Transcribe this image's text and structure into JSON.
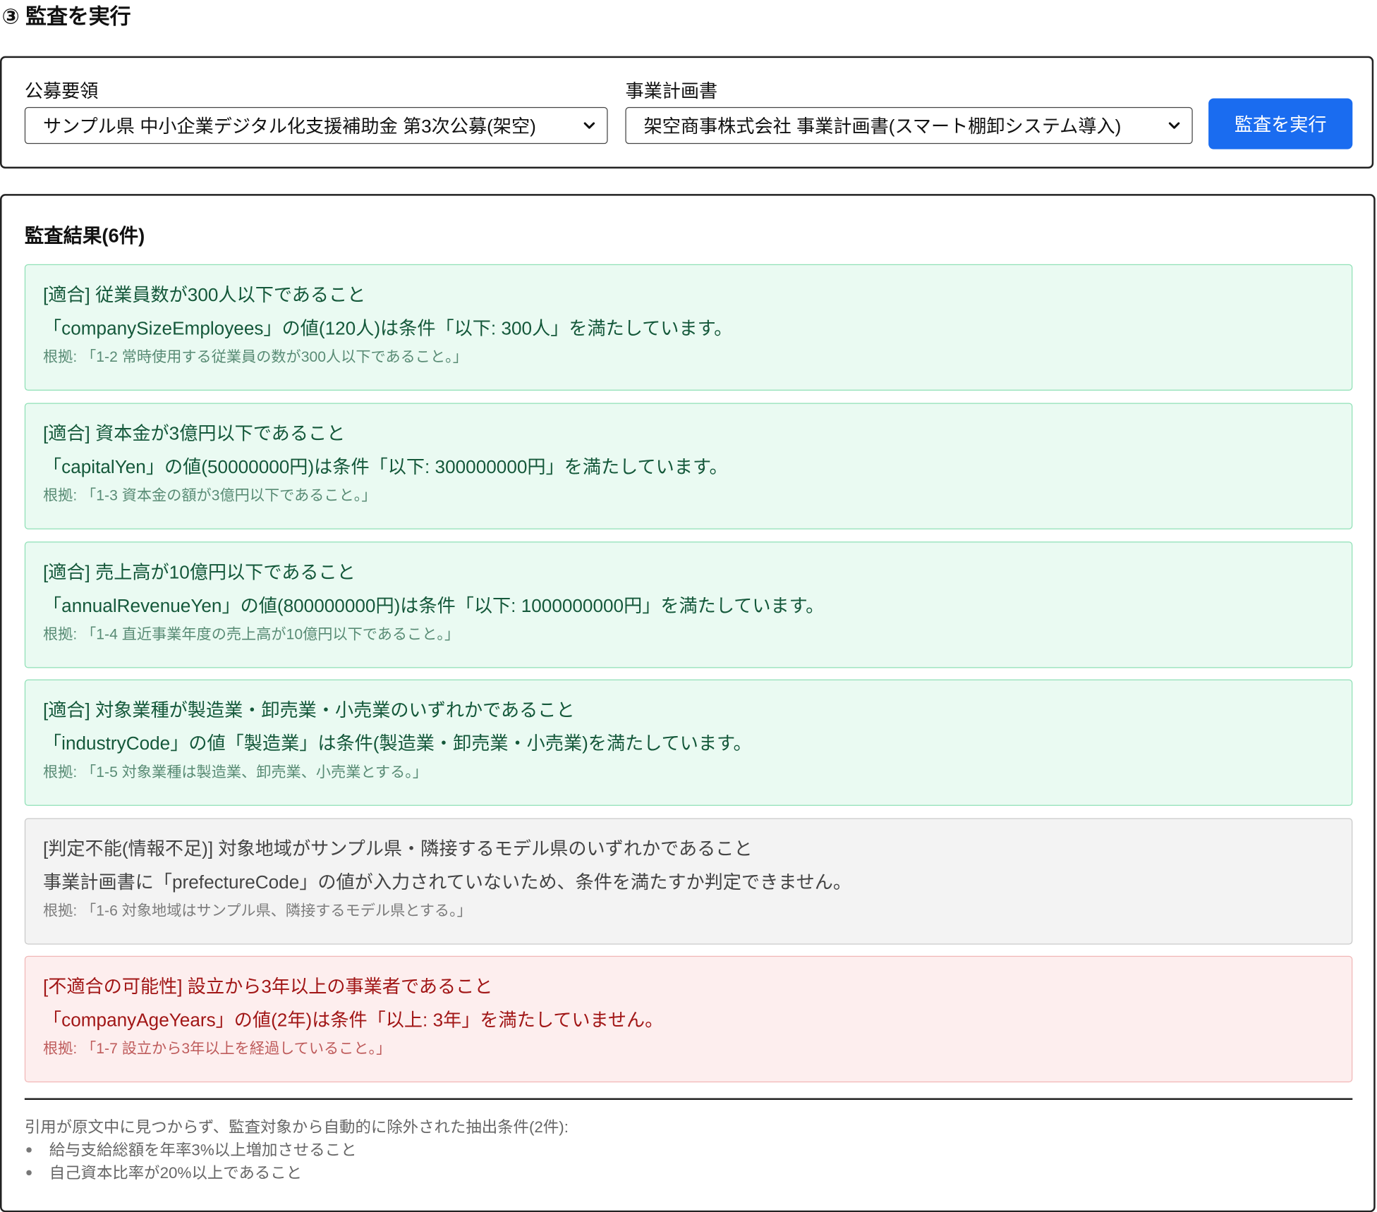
{
  "section": {
    "title": "③ 監査を実行"
  },
  "controls": {
    "guideline_label": "公募要領",
    "guideline_value": "サンプル県 中小企業デジタル化支援補助金 第3次公募(架空)",
    "plan_label": "事業計画書",
    "plan_value": "架空商事株式会社 事業計画書(スマート棚卸システム導入)",
    "run_button": "監査を実行"
  },
  "results": {
    "title": "監査結果(6件)",
    "items": [
      {
        "status": "pass",
        "title": "[適合] 従業員数が300人以下であること",
        "message": "「companySizeEmployees」の値(120人)は条件「以下: 300人」を満たしています。",
        "basis": "根拠: 「1-2 常時使用する従業員の数が300人以下であること。」"
      },
      {
        "status": "pass",
        "title": "[適合] 資本金が3億円以下であること",
        "message": "「capitalYen」の値(50000000円)は条件「以下: 300000000円」を満たしています。",
        "basis": "根拠: 「1-3 資本金の額が3億円以下であること。」"
      },
      {
        "status": "pass",
        "title": "[適合] 売上高が10億円以下であること",
        "message": "「annualRevenueYen」の値(800000000円)は条件「以下: 1000000000円」を満たしています。",
        "basis": "根拠: 「1-4 直近事業年度の売上高が10億円以下であること。」"
      },
      {
        "status": "pass",
        "title": "[適合] 対象業種が製造業・卸売業・小売業のいずれかであること",
        "message": "「industryCode」の値「製造業」は条件(製造業・卸売業・小売業)を満たしています。",
        "basis": "根拠: 「1-5 対象業種は製造業、卸売業、小売業とする。」"
      },
      {
        "status": "unknown",
        "title": "[判定不能(情報不足)] 対象地域がサンプル県・隣接するモデル県のいずれかであること",
        "message": "事業計画書に「prefectureCode」の値が入力されていないため、条件を満たすか判定できません。",
        "basis": "根拠: 「1-6 対象地域はサンプル県、隣接するモデル県とする。」"
      },
      {
        "status": "fail",
        "title": "[不適合の可能性] 設立から3年以上の事業者であること",
        "message": "「companyAgeYears」の値(2年)は条件「以上: 3年」を満たしていません。",
        "basis": "根拠: 「1-7 設立から3年以上を経過していること。」"
      }
    ]
  },
  "excluded": {
    "heading": "引用が原文中に見つからず、監査対象から自動的に除外された抽出条件(2件):",
    "items": [
      "給与支給総額を年率3%以上増加させること",
      "自己資本比率が20%以上であること"
    ]
  },
  "colors": {
    "accent": "#1a6cf0",
    "pass_bg": "#eafaf2",
    "pass_border": "#8fe0b6",
    "pass_text": "#14583a",
    "unknown_bg": "#f3f3f3",
    "unknown_border": "#c9c9c9",
    "unknown_text": "#444444",
    "fail_bg": "#fdeeee",
    "fail_border": "#f1b7b7",
    "fail_text": "#a11616"
  },
  "icons": {
    "select_chevron": "chevron-down-icon"
  }
}
